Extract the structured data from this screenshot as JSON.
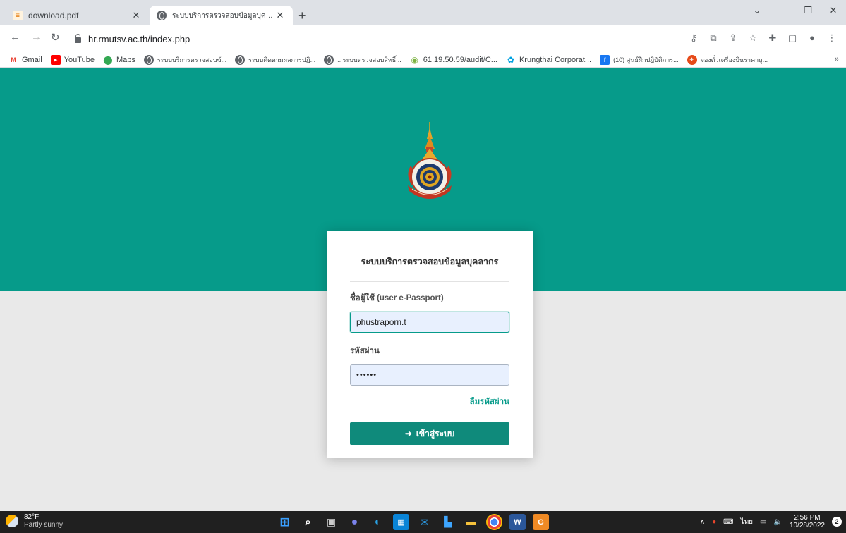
{
  "browser": {
    "tabs": [
      {
        "title": "download.pdf",
        "icon": "pdf-icon",
        "active": false
      },
      {
        "title": "ระบบบริการตรวจสอบข้อมูลบุคลากร",
        "icon": "globe-icon",
        "active": true
      }
    ],
    "new_tab": "+",
    "window_controls": {
      "minimize": "—",
      "restore": "❐",
      "close": "✕",
      "tabsearch": "⌄"
    },
    "url": "hr.rmutsv.ac.th/index.php",
    "bookmarks": [
      {
        "label": "Gmail",
        "icon": "gmail-icon",
        "color": "#ea4335"
      },
      {
        "label": "YouTube",
        "icon": "youtube-icon",
        "color": "#ff0000"
      },
      {
        "label": "Maps",
        "icon": "maps-icon",
        "color": "#34a853"
      },
      {
        "label": "ระบบบริการตรวจสอบข้...",
        "icon": "globe-icon",
        "color": "#5f6368"
      },
      {
        "label": "ระบบติดตามผลการปฏิ...",
        "icon": "globe-icon",
        "color": "#5f6368"
      },
      {
        "label": ":: ระบบตรวจสอบสิทธิ์...",
        "icon": "globe-icon",
        "color": "#5f6368"
      },
      {
        "label": "61.19.50.59/audit/C...",
        "icon": "globe-green-icon",
        "color": "#7cb342"
      },
      {
        "label": "Krungthai Corporat...",
        "icon": "krungthai-icon",
        "color": "#00a1e0"
      },
      {
        "label": "(10) ศูนย์ฝึกปฏิบัติการ...",
        "icon": "facebook-icon",
        "color": "#1877f2"
      },
      {
        "label": "จองตั๋วเครื่องบินราคาถู...",
        "icon": "ticket-icon",
        "color": "#e64a19"
      }
    ],
    "bookmarks_more": "»"
  },
  "page": {
    "hero_color": "#069b8a",
    "login": {
      "title": "ระบบบริการตรวจสอบข้อมูลบุคลากร",
      "username_label": "ชื่อผู้ใช้",
      "username_sub": "(user e-Passport)",
      "username_value": "phustraporn.t",
      "password_label": "รหัสผ่าน",
      "password_value": "••••••",
      "forgot_link": "ลืมรหัสผ่าน",
      "login_button": "เข้าสู่ระบบ"
    }
  },
  "taskbar": {
    "weather_temp": "82°F",
    "weather_desc": "Partly sunny",
    "apps": [
      "windows-start-icon",
      "search-icon",
      "task-view-icon",
      "teams-chat-icon",
      "edge-icon",
      "store-icon",
      "mail-icon",
      "photos-icon",
      "file-explorer-icon",
      "chrome-icon",
      "word-icon",
      "app-icon"
    ],
    "language": "ไทย",
    "time": "2:56 PM",
    "date": "10/28/2022",
    "notifications": "2"
  }
}
